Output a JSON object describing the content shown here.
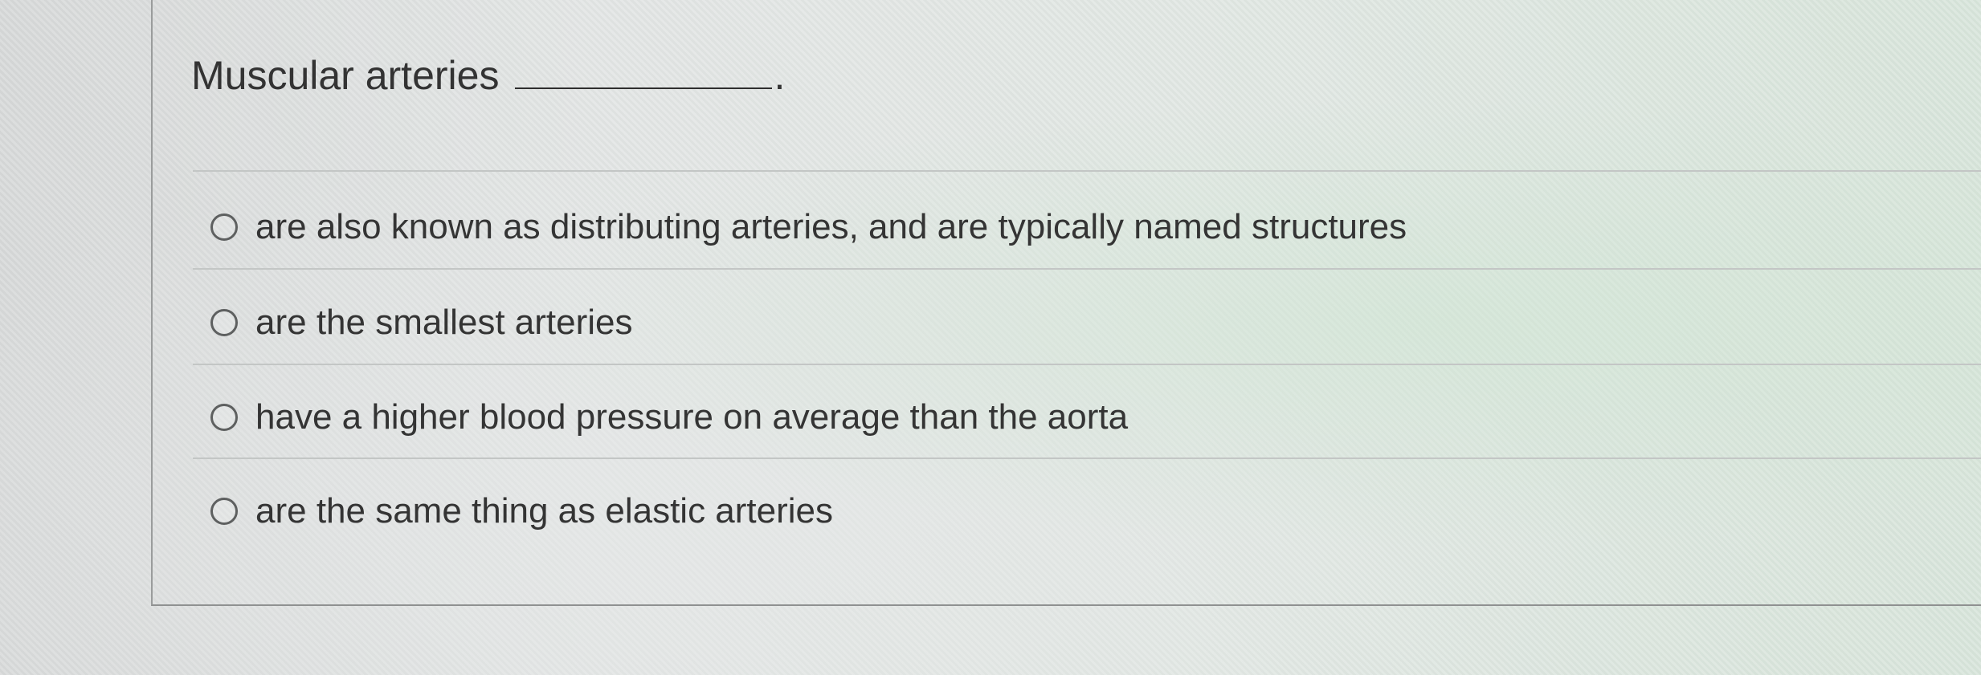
{
  "question": {
    "text": "Muscular arteries",
    "blank_suffix": "."
  },
  "options": [
    {
      "label": "are also known as distributing arteries, and are typically named structures",
      "selected": false
    },
    {
      "label": "are the smallest arteries",
      "selected": false
    },
    {
      "label": "have a higher blood pressure on average than the aorta",
      "selected": false
    },
    {
      "label": "are the same thing as elastic arteries",
      "selected": false
    }
  ]
}
